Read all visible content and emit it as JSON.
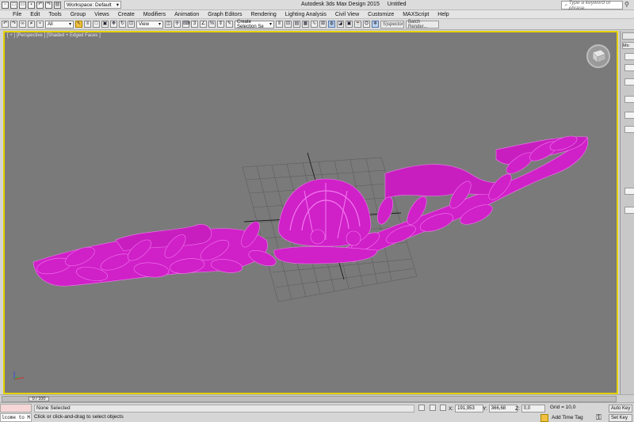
{
  "titlebar": {
    "workspace": "Workspace: Default",
    "app_name": "Autodesk 3ds Max Design 2015",
    "file_name": "Untitled",
    "search_placeholder": "Type a keyword or phrase"
  },
  "menu": [
    "File",
    "Edit",
    "Tools",
    "Group",
    "Views",
    "Create",
    "Modifiers",
    "Animation",
    "Graph Editors",
    "Rendering",
    "Lighting Analysis",
    "Civil View",
    "Customize",
    "MAXScript",
    "Help"
  ],
  "toolbar": {
    "filter_select": "All",
    "ref_coord": "View",
    "selection_set": "Create Selection Se",
    "scene_explorer": "S)spector",
    "batch_render": "Batch Render..."
  },
  "viewport": {
    "label": "[ + ] [Perspective ] [Shaded + Edged Faces ]",
    "background": "#7a7a7a",
    "object_color": "#d020c8",
    "wire_color": "#ee66ea",
    "active_border": "#e5d200"
  },
  "timeline": {
    "frame": "0 / 100"
  },
  "status": {
    "maxscript_text": "lcome to M",
    "selection": "None Selected",
    "prompt": "Click or click-and-drag to select objects",
    "x_label": "X:",
    "x_value": "191,953",
    "y_label": "Y:",
    "y_value": "366,68",
    "z_label": "Z:",
    "z_value": "0,0",
    "grid": "Grid = 10,0",
    "add_time_tag": "Add Time Tag",
    "auto_key": "Auto Key",
    "set_key": "Set Key"
  },
  "cmdpanel": {
    "tab_label": "Mo"
  }
}
